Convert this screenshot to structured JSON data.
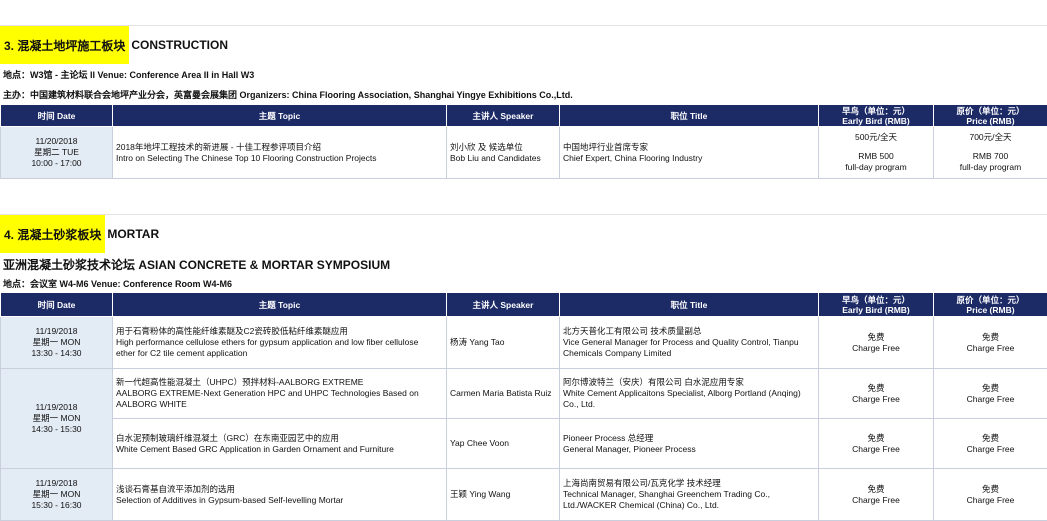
{
  "section3": {
    "title_cn": "3. 混凝土地坪施工板块",
    "title_en": "CONSTRUCTION",
    "location": "地点：W3馆 - 主论坛 II    Venue: Conference Area II in Hall W3",
    "organizer": "主办：中国建筑材料联合会地坪产业分会，英富曼会展集团    Organizers:  China Flooring Association, Shanghai Yingye Exhibitions Co.,Ltd.",
    "headers": {
      "time": "时间  Date",
      "topic": "主题  Topic",
      "speaker": "主讲人 Speaker",
      "title": "职位  Title",
      "early": "早鸟（单位：元）",
      "early_en": "Early Bird (RMB)",
      "price": "原价（单位：元）",
      "price_en": "Price (RMB)"
    },
    "rows": [
      {
        "date": "11/20/2018",
        "weekday": "星期二  TUE",
        "time": "10:00 - 17:00",
        "topic_cn": "2018年地坪工程技术的新进展 - 十佳工程参评项目介绍",
        "topic_en": "Intro on Selecting The Chinese Top 10 Flooring Construction Projects",
        "speaker_cn": "刘小欣 及 候选单位",
        "speaker_en": "Bob Liu and Candidates",
        "title_cn": "中国地坪行业首席专家",
        "title_en": "Chief Expert, China Flooring Industry",
        "early_1": "500元/全天",
        "early_2": "RMB 500",
        "early_3": "full-day program",
        "price_1": "700元/全天",
        "price_2": "RMB 700",
        "price_3": "full-day program"
      }
    ]
  },
  "section4": {
    "title_cn": "4. 混凝土砂浆板块",
    "title_en": "MORTAR",
    "symposium": "亚洲混凝土砂浆技术论坛    ASIAN CONCRETE & MORTAR SYMPOSIUM",
    "location": "地点：会议室 W4-M6    Venue: Conference Room W4-M6",
    "headers": {
      "time": "时间  Date",
      "topic": "主题  Topic",
      "speaker": "主讲人 Speaker",
      "title": "职位  Title",
      "early": "早鸟（单位：元）",
      "early_en": "Early Bird (RMB)",
      "price": "原价（单位：元）",
      "price_en": "Price (RMB)"
    },
    "rows": [
      {
        "date": "11/19/2018",
        "weekday": "星期一  MON",
        "time": "13:30 - 14:30",
        "topic_1": "用于石膏粉体的高性能纤维素醚及C2瓷砖胶低粘纤维素醚应用",
        "topic_2": "High performance cellulose ethers for gypsum application and low fiber cellulose",
        "topic_3": "ether for C2 tile cement application",
        "speaker": "杨涛  Yang Tao",
        "title_1": "北方天普化工有限公司 技术质量副总",
        "title_2": "Vice General Manager for Process and Quality Control, Tianpu",
        "title_3": "Chemicals Company Limited",
        "early_1": "免费",
        "early_2": "Charge Free",
        "price_1": "免费",
        "price_2": "Charge Free"
      },
      {
        "date": "11/19/2018",
        "weekday": "星期一  MON",
        "time": "14:30 - 15:30",
        "topic_1": "新一代超高性能混凝土（UHPC）预拌材料-AALBORG EXTREME",
        "topic_2": "AALBORG EXTREME-Next Generation HPC and UHPC Technologies Based on",
        "topic_3": "AALBORG WHITE",
        "speaker": "Carmen Maria Batista Ruiz",
        "title_1": "阿尔博波特兰（安庆）有限公司 白水泥应用专家",
        "title_2": "White Cement Applicaitons Specialist, Alborg Portland (Anqing)",
        "title_3": "Co., Ltd.",
        "early_1": "免费",
        "early_2": "Charge Free",
        "price_1": "免费",
        "price_2": "Charge Free"
      },
      {
        "topic_1": "白水泥预制玻璃纤维混凝土（GRC）在东南亚园艺中的应用",
        "topic_2": "White Cement Based GRC Application in Garden Ornament and Furniture",
        "speaker": "Yap Chee Voon",
        "title_1": "Pioneer Process 总经理",
        "title_2": "General Manager, Pioneer Process",
        "early_1": "免费",
        "early_2": "Charge Free",
        "price_1": "免费",
        "price_2": "Charge Free"
      },
      {
        "date": "11/19/2018",
        "weekday": "星期一  MON",
        "time": "15:30 - 16:30",
        "topic_1": "浅谈石膏基自流平添加剂的选用",
        "topic_2": "Selection of Additives in Gypsum-based Self-levelling Mortar",
        "speaker": "王颖  Ying Wang",
        "title_1": "上海尚南贸易有限公司/瓦克化学 技术经理",
        "title_2": "Technical Manager, Shanghai Greenchem Trading Co.,",
        "title_3": "Ltd./WACKER Chemical (China) Co., Ltd.",
        "early_1": "免费",
        "early_2": "Charge Free",
        "price_1": "免费",
        "price_2": "Charge Free"
      }
    ]
  }
}
